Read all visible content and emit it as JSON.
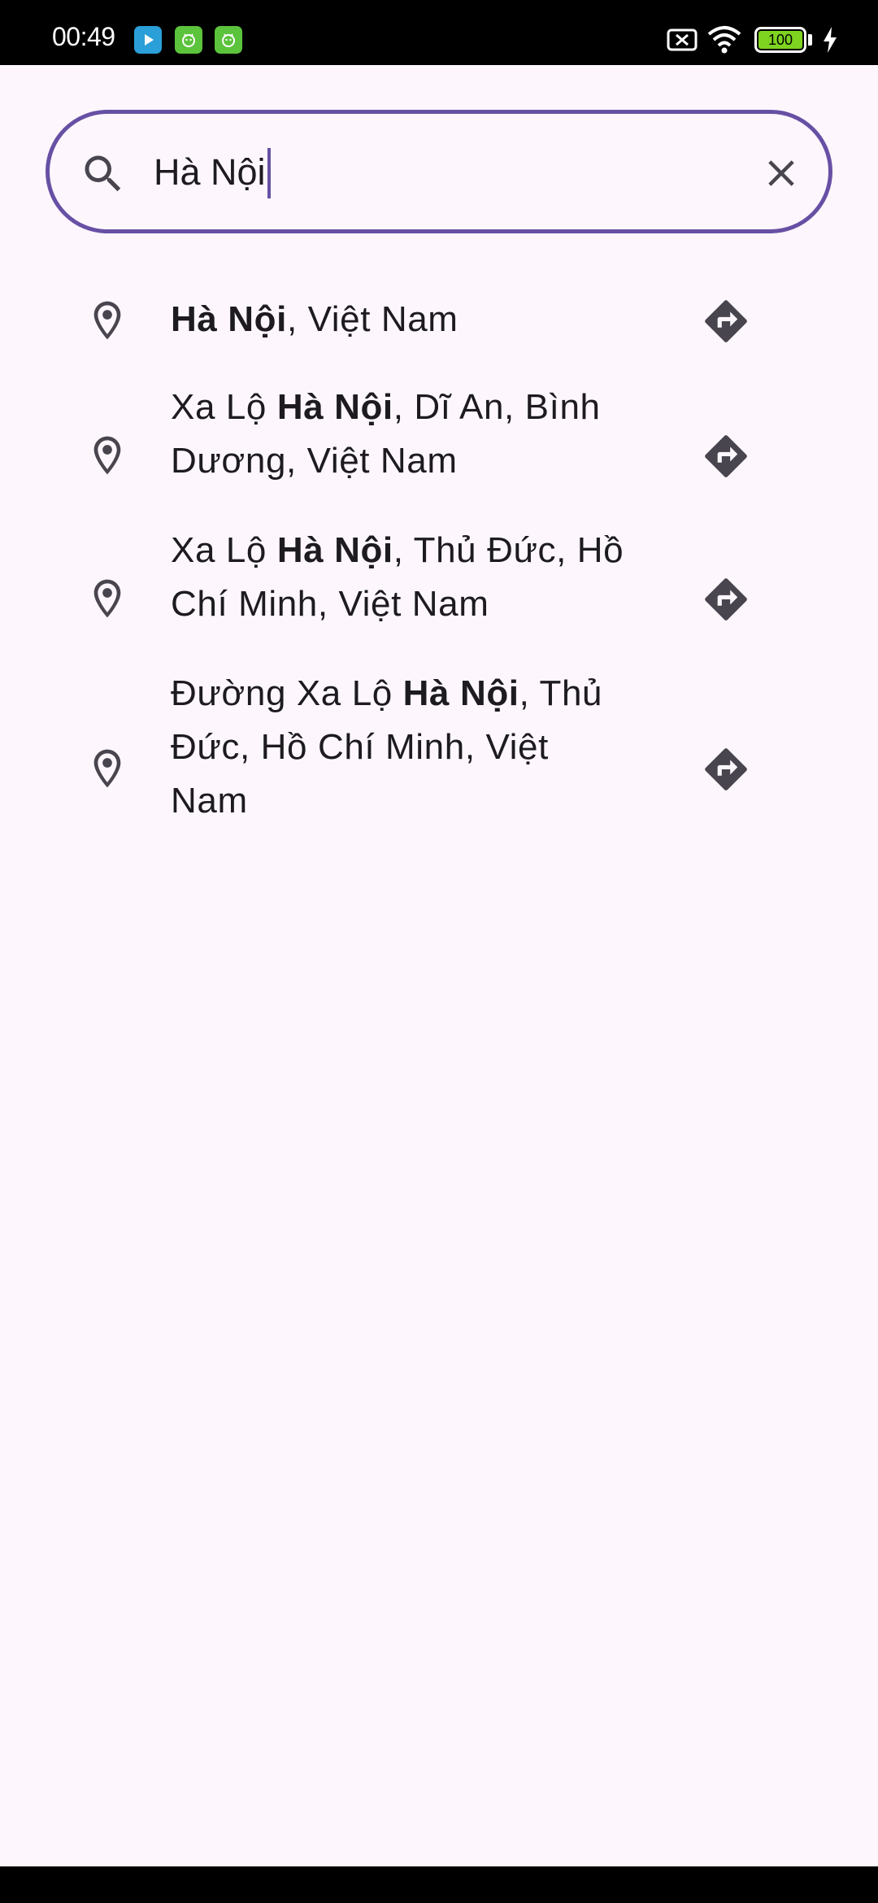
{
  "status_bar": {
    "time": "00:49",
    "battery": "100",
    "app_icons": [
      "video-player-icon",
      "android-app-icon",
      "android-app-icon"
    ]
  },
  "search": {
    "value": "Hà Nội",
    "clear_icon": "close-icon",
    "search_icon": "search-icon"
  },
  "results": [
    {
      "match": "Hà Nội",
      "prefix": "",
      "suffix": ", Việt Nam"
    },
    {
      "prefix": "Xa Lộ ",
      "match": "Hà Nội",
      "suffix": ", Dĩ An, Bình Dương, Việt Nam"
    },
    {
      "prefix": "Xa Lộ ",
      "match": "Hà Nội",
      "suffix": ", Thủ Đức, Hồ Chí Minh, Việt Nam"
    },
    {
      "prefix": "Đường Xa Lộ ",
      "match": "Hà Nội",
      "suffix": ", Thủ Đức, Hồ Chí Minh, Việt Nam"
    }
  ],
  "colors": {
    "accent": "#6750a4",
    "background": "#fdf7fd",
    "text": "#1d1b20",
    "icon": "#49454f"
  }
}
